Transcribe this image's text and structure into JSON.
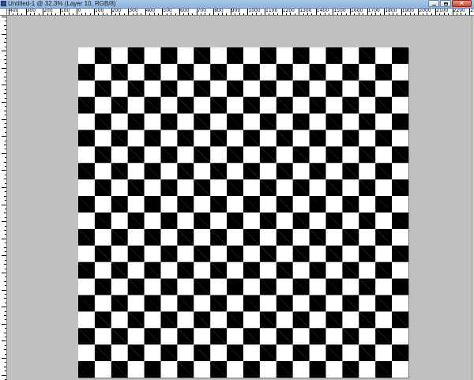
{
  "window": {
    "title": "Untitled-1 @ 32.3% (Layer 10, RGB/8)"
  },
  "ruler": {
    "labels": [
      "400",
      "300",
      "200",
      "100",
      "0",
      "100",
      "200",
      "300",
      "400",
      "500",
      "600",
      "700",
      "800",
      "900",
      "1000",
      "1100",
      "1200",
      "1300",
      "1400",
      "1500",
      "1600",
      "1700",
      "1800",
      "1900",
      "2000",
      "2100",
      "2200",
      "230"
    ]
  },
  "canvas": {
    "pattern": "checkerboard",
    "rows": 20,
    "columns": 20,
    "colors": [
      "#000000",
      "#ffffff"
    ]
  },
  "colors": {
    "background": "#c0c0c0",
    "titlebar": "#a9c8ea",
    "close_button": "#c5452f"
  },
  "icons": {
    "document": "document-icon",
    "minimize": "minimize-icon",
    "maximize": "maximize-icon",
    "close": "close-icon"
  },
  "buttons": {
    "close_glyph": "✕"
  }
}
